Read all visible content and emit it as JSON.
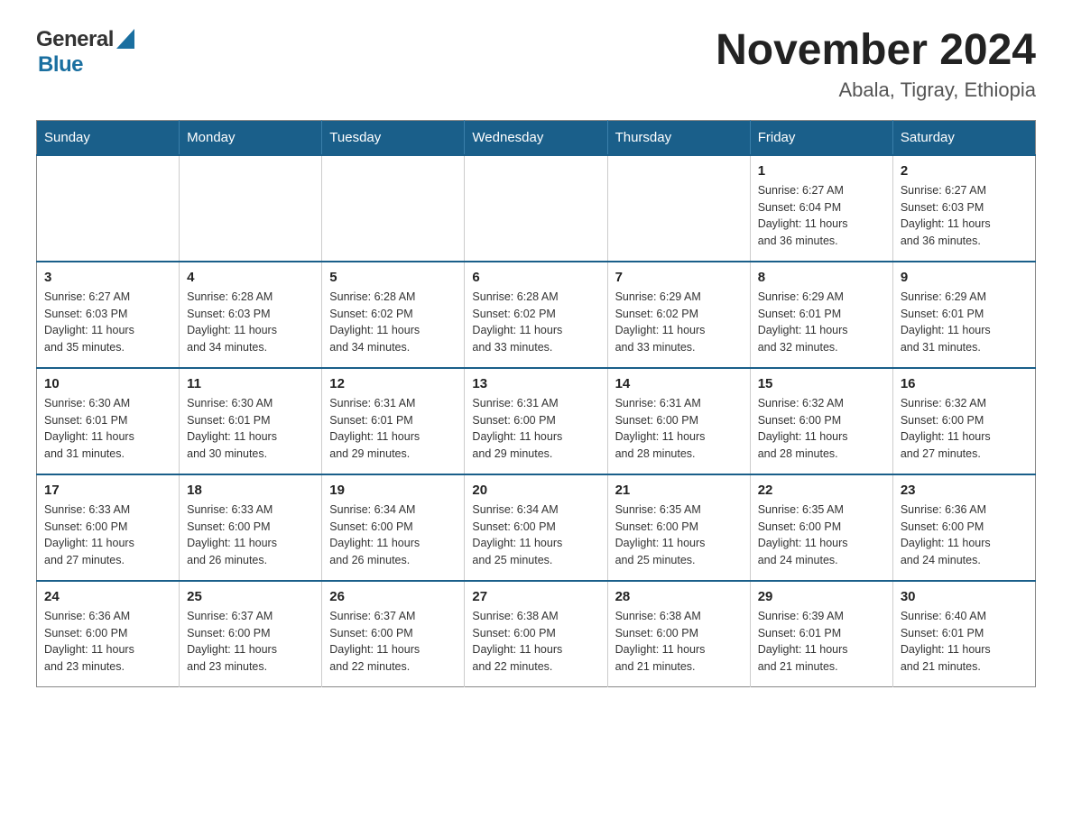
{
  "header": {
    "logo_general": "General",
    "logo_blue": "Blue",
    "month_title": "November 2024",
    "location": "Abala, Tigray, Ethiopia"
  },
  "calendar": {
    "days_of_week": [
      "Sunday",
      "Monday",
      "Tuesday",
      "Wednesday",
      "Thursday",
      "Friday",
      "Saturday"
    ],
    "weeks": [
      [
        {
          "day": "",
          "info": ""
        },
        {
          "day": "",
          "info": ""
        },
        {
          "day": "",
          "info": ""
        },
        {
          "day": "",
          "info": ""
        },
        {
          "day": "",
          "info": ""
        },
        {
          "day": "1",
          "info": "Sunrise: 6:27 AM\nSunset: 6:04 PM\nDaylight: 11 hours\nand 36 minutes."
        },
        {
          "day": "2",
          "info": "Sunrise: 6:27 AM\nSunset: 6:03 PM\nDaylight: 11 hours\nand 36 minutes."
        }
      ],
      [
        {
          "day": "3",
          "info": "Sunrise: 6:27 AM\nSunset: 6:03 PM\nDaylight: 11 hours\nand 35 minutes."
        },
        {
          "day": "4",
          "info": "Sunrise: 6:28 AM\nSunset: 6:03 PM\nDaylight: 11 hours\nand 34 minutes."
        },
        {
          "day": "5",
          "info": "Sunrise: 6:28 AM\nSunset: 6:02 PM\nDaylight: 11 hours\nand 34 minutes."
        },
        {
          "day": "6",
          "info": "Sunrise: 6:28 AM\nSunset: 6:02 PM\nDaylight: 11 hours\nand 33 minutes."
        },
        {
          "day": "7",
          "info": "Sunrise: 6:29 AM\nSunset: 6:02 PM\nDaylight: 11 hours\nand 33 minutes."
        },
        {
          "day": "8",
          "info": "Sunrise: 6:29 AM\nSunset: 6:01 PM\nDaylight: 11 hours\nand 32 minutes."
        },
        {
          "day": "9",
          "info": "Sunrise: 6:29 AM\nSunset: 6:01 PM\nDaylight: 11 hours\nand 31 minutes."
        }
      ],
      [
        {
          "day": "10",
          "info": "Sunrise: 6:30 AM\nSunset: 6:01 PM\nDaylight: 11 hours\nand 31 minutes."
        },
        {
          "day": "11",
          "info": "Sunrise: 6:30 AM\nSunset: 6:01 PM\nDaylight: 11 hours\nand 30 minutes."
        },
        {
          "day": "12",
          "info": "Sunrise: 6:31 AM\nSunset: 6:01 PM\nDaylight: 11 hours\nand 29 minutes."
        },
        {
          "day": "13",
          "info": "Sunrise: 6:31 AM\nSunset: 6:00 PM\nDaylight: 11 hours\nand 29 minutes."
        },
        {
          "day": "14",
          "info": "Sunrise: 6:31 AM\nSunset: 6:00 PM\nDaylight: 11 hours\nand 28 minutes."
        },
        {
          "day": "15",
          "info": "Sunrise: 6:32 AM\nSunset: 6:00 PM\nDaylight: 11 hours\nand 28 minutes."
        },
        {
          "day": "16",
          "info": "Sunrise: 6:32 AM\nSunset: 6:00 PM\nDaylight: 11 hours\nand 27 minutes."
        }
      ],
      [
        {
          "day": "17",
          "info": "Sunrise: 6:33 AM\nSunset: 6:00 PM\nDaylight: 11 hours\nand 27 minutes."
        },
        {
          "day": "18",
          "info": "Sunrise: 6:33 AM\nSunset: 6:00 PM\nDaylight: 11 hours\nand 26 minutes."
        },
        {
          "day": "19",
          "info": "Sunrise: 6:34 AM\nSunset: 6:00 PM\nDaylight: 11 hours\nand 26 minutes."
        },
        {
          "day": "20",
          "info": "Sunrise: 6:34 AM\nSunset: 6:00 PM\nDaylight: 11 hours\nand 25 minutes."
        },
        {
          "day": "21",
          "info": "Sunrise: 6:35 AM\nSunset: 6:00 PM\nDaylight: 11 hours\nand 25 minutes."
        },
        {
          "day": "22",
          "info": "Sunrise: 6:35 AM\nSunset: 6:00 PM\nDaylight: 11 hours\nand 24 minutes."
        },
        {
          "day": "23",
          "info": "Sunrise: 6:36 AM\nSunset: 6:00 PM\nDaylight: 11 hours\nand 24 minutes."
        }
      ],
      [
        {
          "day": "24",
          "info": "Sunrise: 6:36 AM\nSunset: 6:00 PM\nDaylight: 11 hours\nand 23 minutes."
        },
        {
          "day": "25",
          "info": "Sunrise: 6:37 AM\nSunset: 6:00 PM\nDaylight: 11 hours\nand 23 minutes."
        },
        {
          "day": "26",
          "info": "Sunrise: 6:37 AM\nSunset: 6:00 PM\nDaylight: 11 hours\nand 22 minutes."
        },
        {
          "day": "27",
          "info": "Sunrise: 6:38 AM\nSunset: 6:00 PM\nDaylight: 11 hours\nand 22 minutes."
        },
        {
          "day": "28",
          "info": "Sunrise: 6:38 AM\nSunset: 6:00 PM\nDaylight: 11 hours\nand 21 minutes."
        },
        {
          "day": "29",
          "info": "Sunrise: 6:39 AM\nSunset: 6:01 PM\nDaylight: 11 hours\nand 21 minutes."
        },
        {
          "day": "30",
          "info": "Sunrise: 6:40 AM\nSunset: 6:01 PM\nDaylight: 11 hours\nand 21 minutes."
        }
      ]
    ]
  }
}
